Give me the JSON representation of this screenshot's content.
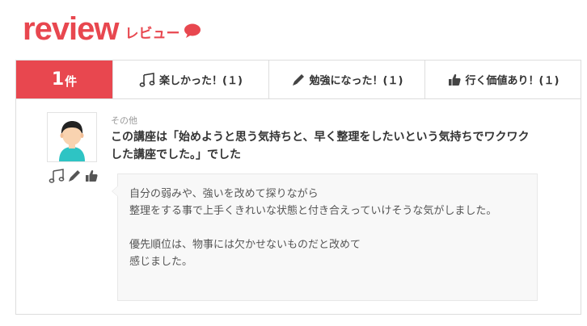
{
  "header": {
    "logo": "review",
    "subtitle": "レビュー"
  },
  "tabs": {
    "count_num": "1",
    "count_unit": "件",
    "items": [
      {
        "label": "楽しかった！(１)",
        "icon": "music-note-icon"
      },
      {
        "label": "勉強になった！(１)",
        "icon": "pencil-icon"
      },
      {
        "label": "行く価値あり！(１)",
        "icon": "thumbs-up-icon"
      }
    ]
  },
  "review": {
    "category": "その他",
    "title": "この講座は「始めようと思う気持ちと、早く整理をしたいという気持ちでワクワクした講座でした。」でした",
    "comment_para1": "自分の弱みや、強いを改めて探りながら\n整理をする事で上手くきれいな状態と付き合えっていけそうな気がしました。",
    "comment_para2": "優先順位は、物事には欠かせないものだと改めて\n感じました。"
  },
  "colors": {
    "accent": "#e8474f",
    "text": "#333333",
    "muted": "#999999"
  }
}
